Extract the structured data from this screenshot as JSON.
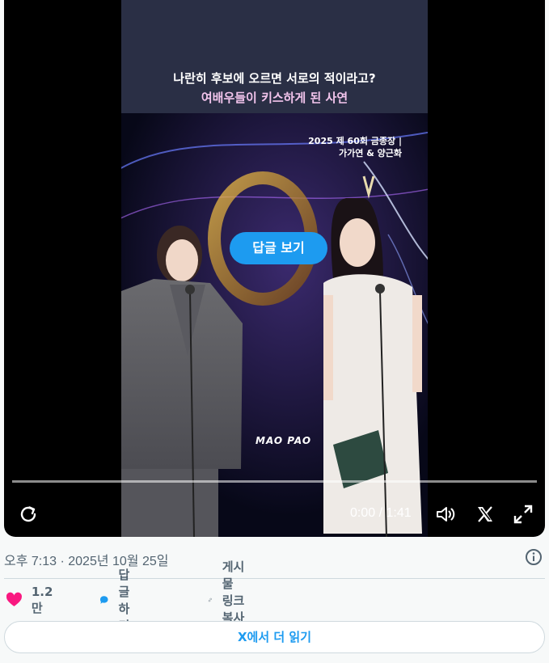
{
  "video": {
    "caption_line1": "나란히 후보에 오르면 서로의 적이라고?",
    "caption_line2": "여배우들이 키스하게 된 사연",
    "event_line1": "2025 제 60회 금종장 |",
    "event_line2": "가가연 & 양근화",
    "logo_text": "MAO PAO",
    "reply_overlay_label": "답글 보기",
    "progress": 0.0,
    "time_display": "0:00 / 1:41"
  },
  "meta": {
    "timestamp": "오후 7:13 · 2025년 10월 25일"
  },
  "actions": {
    "like_count": "1.2만",
    "reply_label": "답글하기",
    "copy_link_label": "게시물 링크 복사하기"
  },
  "read_more_label": "X에서 더 읽기",
  "colors": {
    "accent": "#1d9bf0",
    "like": "#f91880",
    "secondary_text": "#536471",
    "caption_pink": "#f2c4ec"
  }
}
